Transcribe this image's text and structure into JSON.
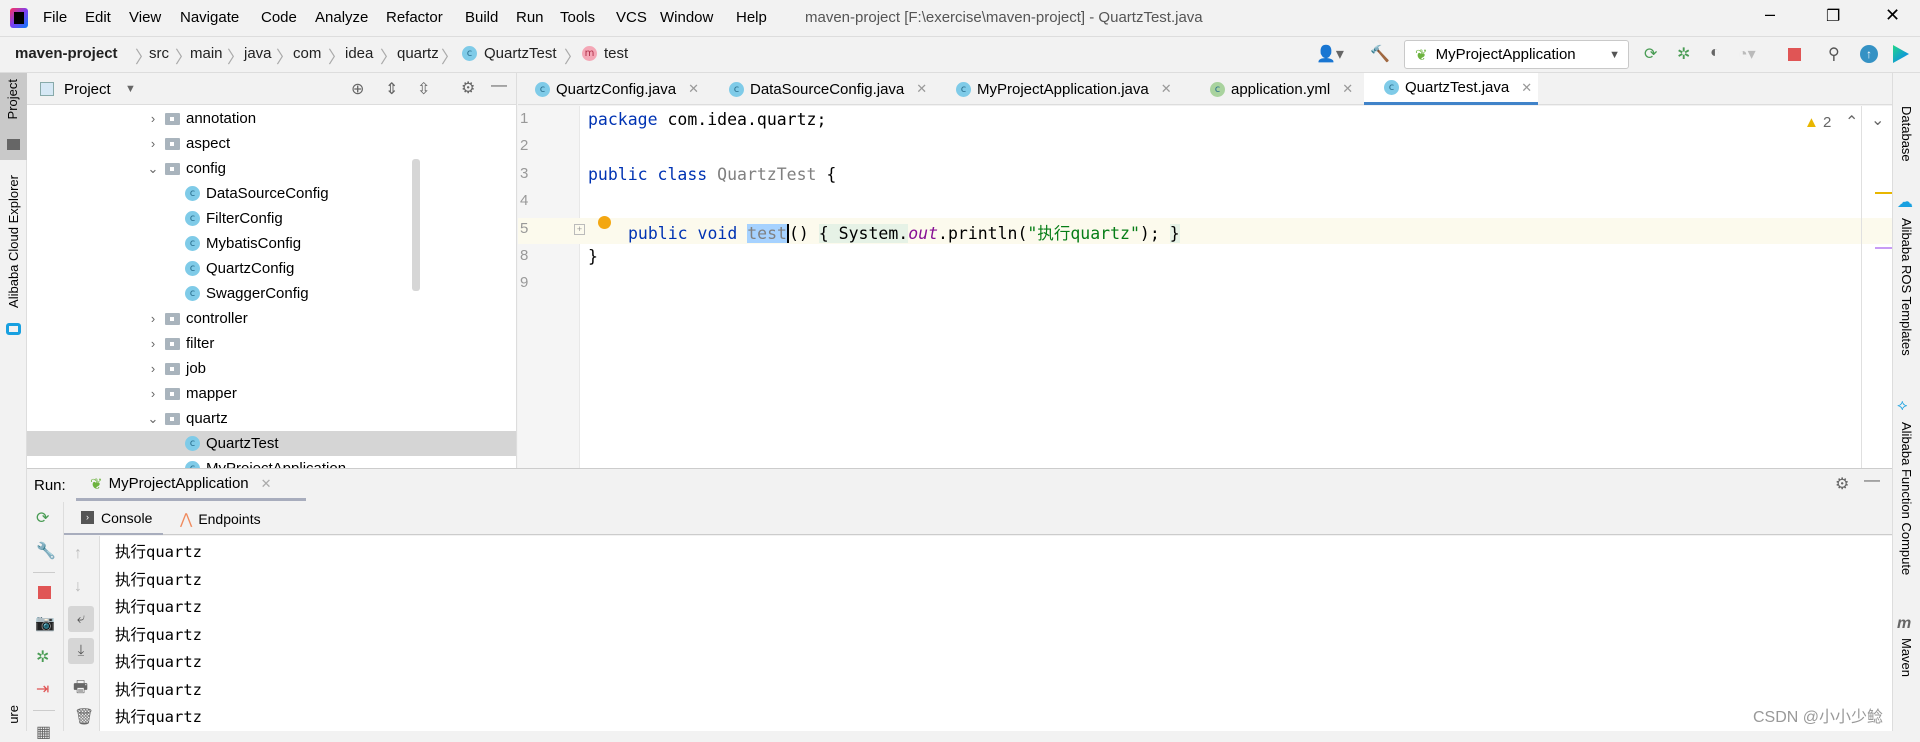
{
  "menu": {
    "items": [
      "File",
      "Edit",
      "View",
      "Navigate",
      "Code",
      "Analyze",
      "Refactor",
      "Build",
      "Run",
      "Tools",
      "VCS",
      "Window",
      "Help"
    ],
    "window_title": "maven-project [F:\\exercise\\maven-project] - QuartzTest.java"
  },
  "breadcrumb": [
    "maven-project",
    "src",
    "main",
    "java",
    "com",
    "idea",
    "quartz",
    "QuartzTest",
    "test"
  ],
  "toolbar": {
    "run_config": "MyProjectApplication"
  },
  "left_strip": {
    "project": "Project",
    "cloud": "Alibaba Cloud Explorer",
    "structure": "ure"
  },
  "project_panel": {
    "title": "Project",
    "tree": [
      {
        "label": "annotation",
        "type": "folder",
        "open": false
      },
      {
        "label": "aspect",
        "type": "folder",
        "open": false
      },
      {
        "label": "config",
        "type": "folder",
        "open": true
      },
      {
        "label": "DataSourceConfig",
        "type": "class"
      },
      {
        "label": "FilterConfig",
        "type": "class"
      },
      {
        "label": "MybatisConfig",
        "type": "class"
      },
      {
        "label": "QuartzConfig",
        "type": "class"
      },
      {
        "label": "SwaggerConfig",
        "type": "class"
      },
      {
        "label": "controller",
        "type": "folder",
        "open": false
      },
      {
        "label": "filter",
        "type": "folder",
        "open": false
      },
      {
        "label": "job",
        "type": "folder",
        "open": false
      },
      {
        "label": "mapper",
        "type": "folder",
        "open": false
      },
      {
        "label": "quartz",
        "type": "folder",
        "open": true
      },
      {
        "label": "QuartzTest",
        "type": "class",
        "selected": true
      },
      {
        "label": "MyProjectApplication",
        "type": "app"
      }
    ]
  },
  "editor": {
    "tabs": [
      {
        "label": "QuartzConfig.java"
      },
      {
        "label": "DataSourceConfig.java"
      },
      {
        "label": "MyProjectApplication.java"
      },
      {
        "label": "application.yml"
      },
      {
        "label": "QuartzTest.java",
        "active": true
      }
    ],
    "line_numbers": [
      "1",
      "2",
      "3",
      "4",
      "5",
      "8",
      "9"
    ],
    "code": {
      "l1a": "package",
      " l1b": "",
      "l1c": " com.idea.quartz;",
      "l3a": "public class ",
      "l3b": "QuartzTest",
      "l3c": " {",
      "l5a": "public void ",
      "l5b": "test",
      "l5c": "() ",
      "l5d": "{",
      "l5e": " System.",
      "l5f": "out",
      "l5g": ".println(",
      "l5h": "\"执行quartz\"",
      "l5i": "); ",
      "l5j": "}",
      "l8": "}"
    },
    "warnings": "2"
  },
  "right_strip": [
    "Database",
    "Alibaba ROS Templates",
    "Alibaba Function Compute",
    "Maven"
  ],
  "run": {
    "label": "Run:",
    "tab": "MyProjectApplication",
    "subtabs": [
      "Console",
      "Endpoints"
    ],
    "console": [
      "执行quartz",
      "执行quartz",
      "执行quartz",
      "执行quartz",
      "执行quartz",
      "执行quartz",
      "执行quartz"
    ]
  },
  "watermark": "CSDN @小小少鲶",
  "colors": {
    "accent": "#4083c9",
    "keyword": "#0033b3",
    "string": "#067d17",
    "selection": "#a6d2ff",
    "stop": "#e05555",
    "run": "#499c54"
  }
}
